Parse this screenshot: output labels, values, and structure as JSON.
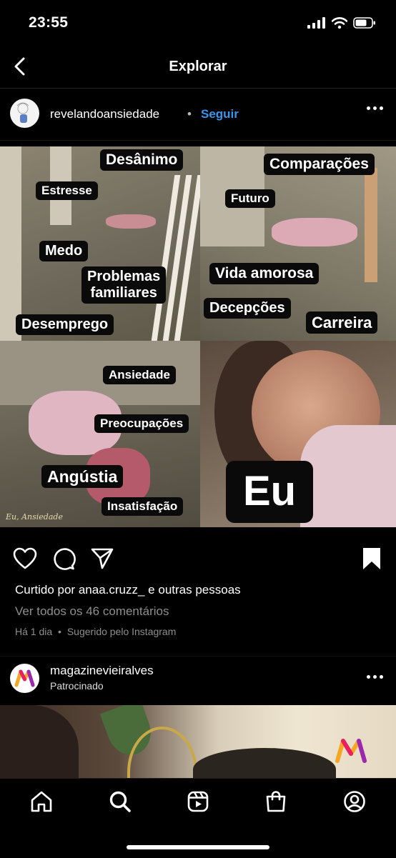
{
  "status_bar": {
    "time": "23:55",
    "battery_icon": "battery-icon",
    "wifi_icon": "wifi-icon",
    "signal_icon": "cellular-signal-icon"
  },
  "header": {
    "title": "Explorar",
    "back_icon": "chevron-left-icon"
  },
  "post": {
    "username": "revelandoansiedade",
    "separator": "•",
    "follow_label": "Seguir",
    "image_labels": {
      "desanimo": "Desânimo",
      "comparacoes": "Comparações",
      "estresse": "Estresse",
      "futuro": "Futuro",
      "medo": "Medo",
      "problemas": "Problemas\nfamiliares",
      "vida_amorosa": "Vida amorosa",
      "decepcoes": "Decepções",
      "carreira": "Carreira",
      "desemprego": "Desemprego",
      "ansiedade": "Ansiedade",
      "preocupacoes": "Preocupações",
      "angustia": "Angústia",
      "insatisfacao": "Insatisfação",
      "eu": "Eu"
    },
    "watermark": "Eu, Ansiedade",
    "liked_prefix": "Curtido por ",
    "liked_user": "anaa.cruzz_",
    "liked_connector": " e ",
    "liked_others": "outras pessoas",
    "comments_link": "Ver todos os 46 comentários",
    "time_ago": "Há 1 dia",
    "meta_separator": "•",
    "suggested": "Sugerido pelo Instagram"
  },
  "ad": {
    "username": "magazinevieiralves",
    "sponsored": "Patrocinado"
  },
  "tabs": [
    "home-icon",
    "search-icon",
    "reels-icon",
    "shop-icon",
    "profile-icon"
  ],
  "colors": {
    "accent": "#3797f0",
    "secondary_text": "#8e8e8e",
    "background": "#000000"
  }
}
